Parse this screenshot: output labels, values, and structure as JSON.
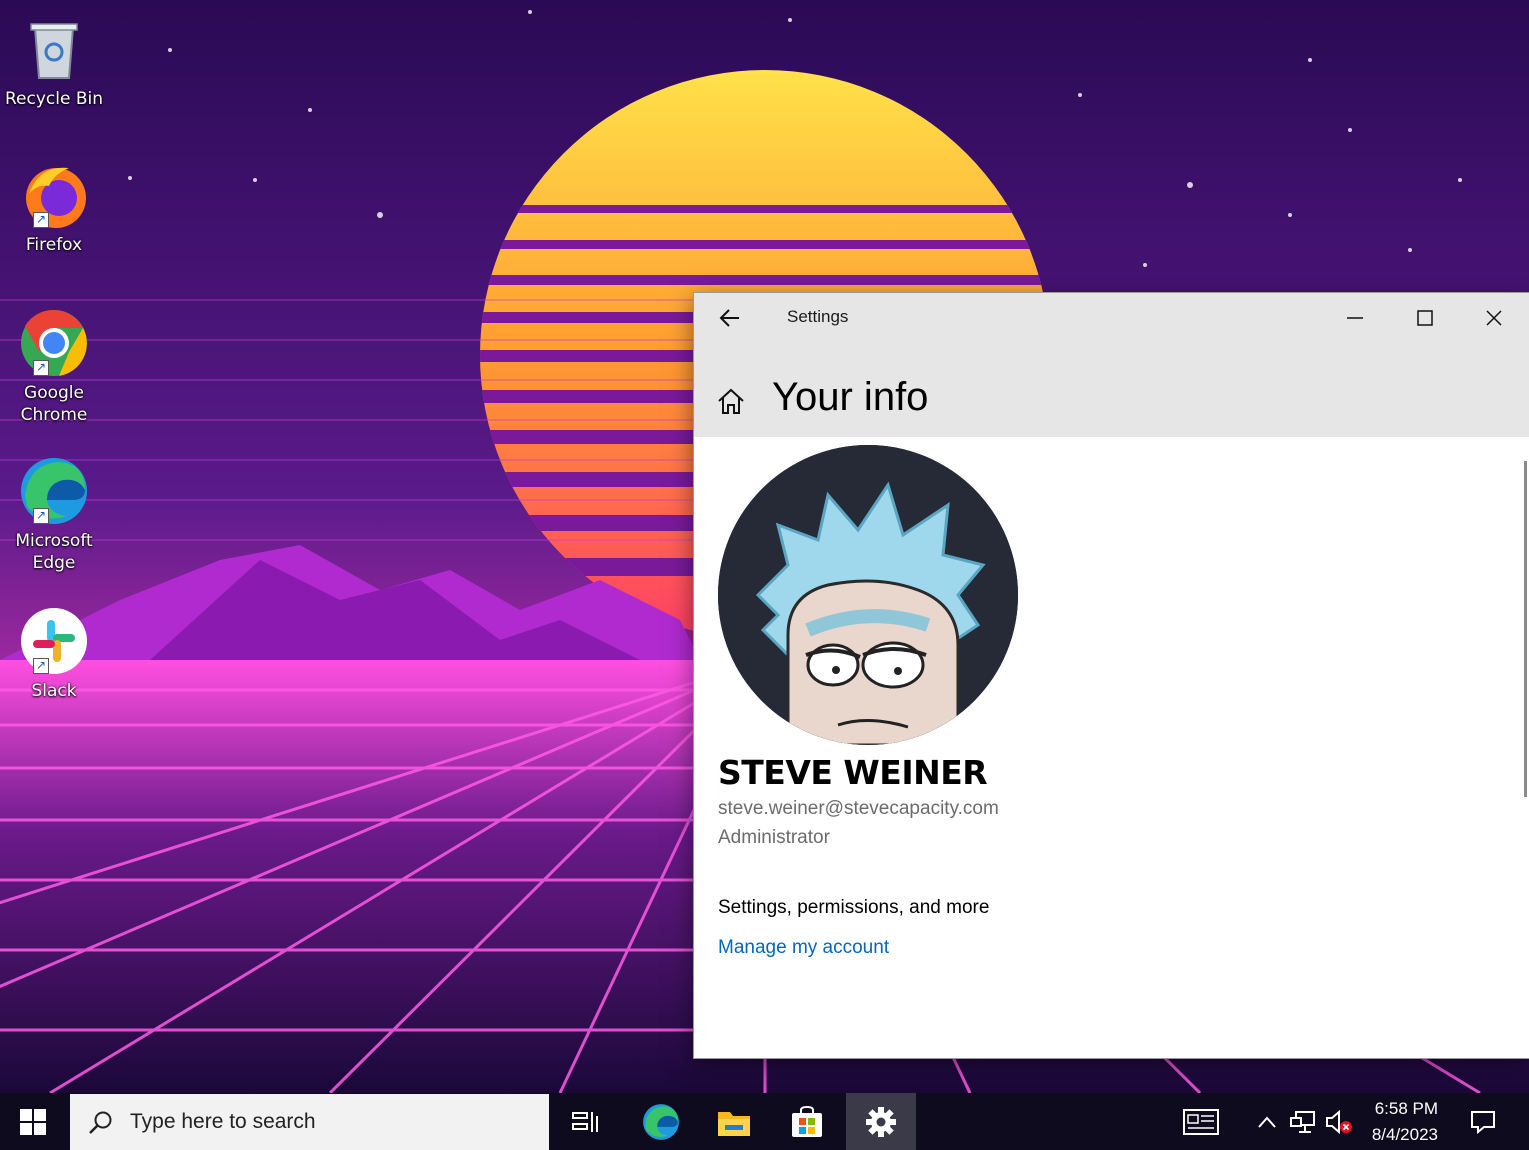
{
  "desktop": {
    "icons": [
      {
        "label": "Recycle Bin",
        "icon": "recycle-bin-icon"
      },
      {
        "label": "Firefox",
        "icon": "firefox-icon"
      },
      {
        "label": "Google Chrome",
        "icon": "chrome-icon"
      },
      {
        "label": "Microsoft Edge",
        "icon": "edge-icon"
      },
      {
        "label": "Slack",
        "icon": "slack-icon"
      }
    ]
  },
  "settings": {
    "window_title": "Settings",
    "page_heading": "Your info",
    "user": {
      "name": "STEVE WEINER",
      "email": "steve.weiner@stevecapacity.com",
      "role": "Administrator"
    },
    "section_label": "Settings, permissions, and more",
    "manage_link": "Manage my account",
    "accent_color": "#0067c0"
  },
  "taskbar": {
    "search_placeholder": "Type here to search",
    "apps": [
      "task-view-icon",
      "edge-icon",
      "file-explorer-icon",
      "microsoft-store-icon",
      "settings-gear-icon"
    ],
    "time": "6:58 PM",
    "date": "8/4/2023"
  }
}
